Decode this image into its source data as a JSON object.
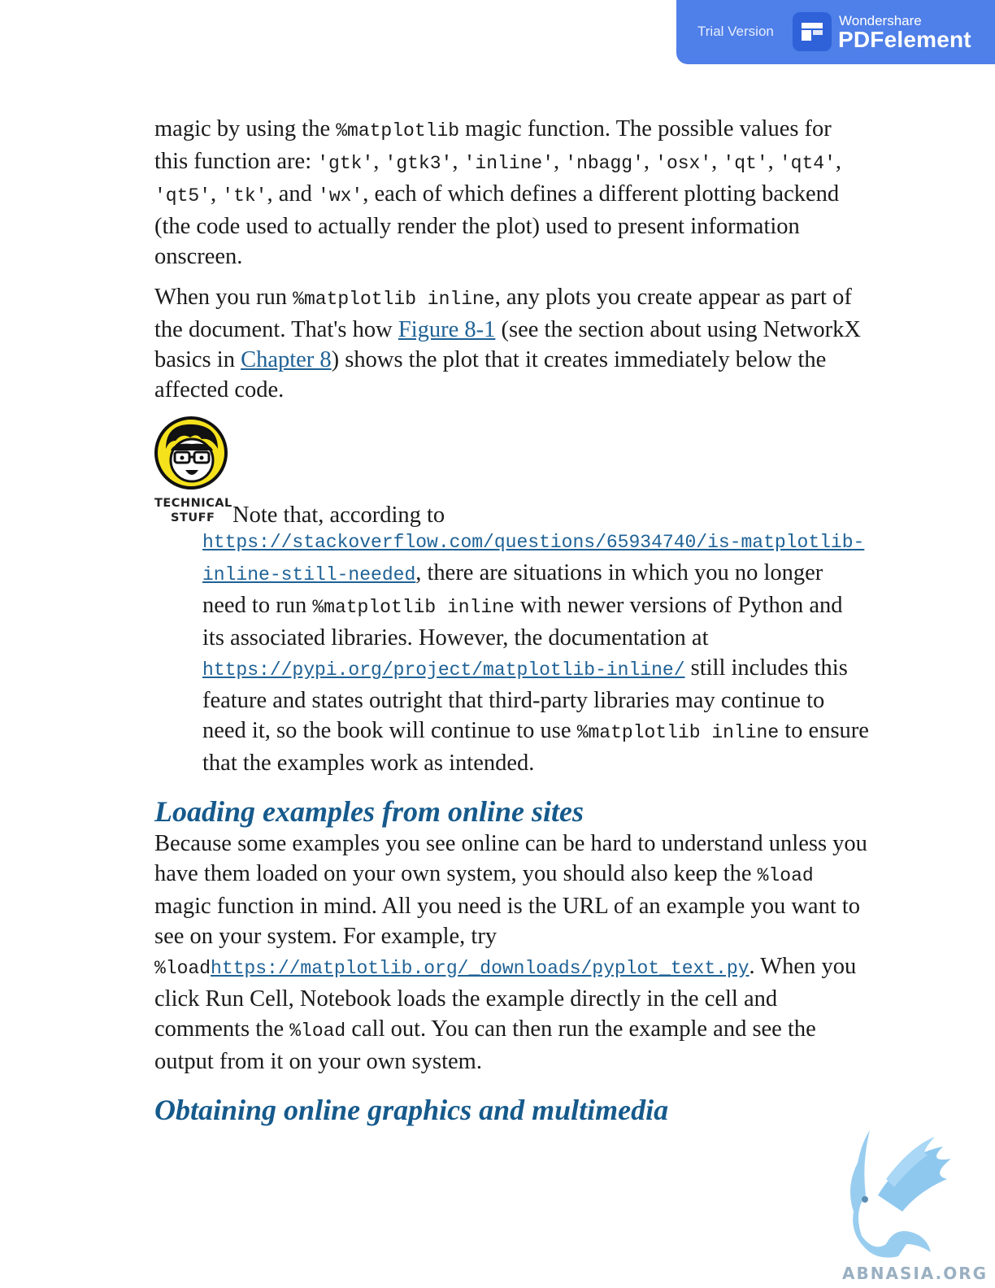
{
  "banner": {
    "trial_label": "Trial Version",
    "brand_top": "Wondershare",
    "brand_main": "PDFelement",
    "accent_color": "#4f7fe8"
  },
  "content": {
    "para1": {
      "t1": "magic by using the ",
      "c1": "%matplotlib",
      "t2": " magic function. The possible values for this function are: ",
      "v1": "'gtk'",
      "s1": ", ",
      "v2": "'gtk3'",
      "s2": ", ",
      "v3": "'inline'",
      "s3": ", ",
      "v4": "'nbagg'",
      "s4": ", ",
      "v5": "'osx'",
      "s5": ", ",
      "v6": "'qt'",
      "s6": ", ",
      "v7": "'qt4'",
      "s7": ", ",
      "v8": "'qt5'",
      "s8": ", ",
      "v9": "'tk'",
      "s9": ", and ",
      "v10": "'wx'",
      "t3": ", each of which defines a different plotting backend (the code used to actually render the plot) used to present information onscreen."
    },
    "para2": {
      "t1": "When you run ",
      "c1": "%matplotlib inline",
      "t2": ", any plots you create appear as part of the document. That's how ",
      "link1": "Figure 8-1",
      "t3": " (see the section about using NetworkX basics in ",
      "link2": "Chapter 8",
      "t4": ") shows the plot that it creates immediately below the affected code."
    },
    "note": {
      "icon_label_1": "TECHNICAL",
      "icon_label_2": "STUFF",
      "first_line": "Note that, according to",
      "link1": "https://stackoverflow.com/questions/65934740/is-matplotlib-inline-still-needed",
      "t1": ", there are situations in which you no longer need to run ",
      "c1": "%matplotlib inline",
      "t2": " with newer versions of Python and its associated libraries. However, the documentation at ",
      "link2": "https://pypi.org/project/matplotlib-inline/",
      "t3": " still includes this feature and states outright that third-party libraries may continue to need it, so the book will continue to use ",
      "c2": "%matplotlib inline",
      "t4": " to ensure that the examples work as intended."
    },
    "heading1": "Loading examples from online sites",
    "para3": {
      "t1": "Because some examples you see online can be hard to understand unless you have them loaded on your own system, you should also keep the ",
      "c1": "%load",
      "t2": " magic function in mind. All you need is the URL of an example you want to see on your system. For example, try ",
      "c2": "%load",
      "link1": "https://matplotlib.org/_downloads/pyplot_text.py",
      "t3": ". When you click Run Cell, Notebook loads the example directly in the cell and comments the ",
      "c3": "%load",
      "t4": " call out. You can then run the example and see the output from it on your own system."
    },
    "heading2": "Obtaining online graphics and multimedia"
  },
  "watermark": {
    "text": "ABNASIA.ORG",
    "icon": "griffin-icon"
  },
  "colors": {
    "heading": "#165a8c",
    "link": "#1f6296"
  }
}
